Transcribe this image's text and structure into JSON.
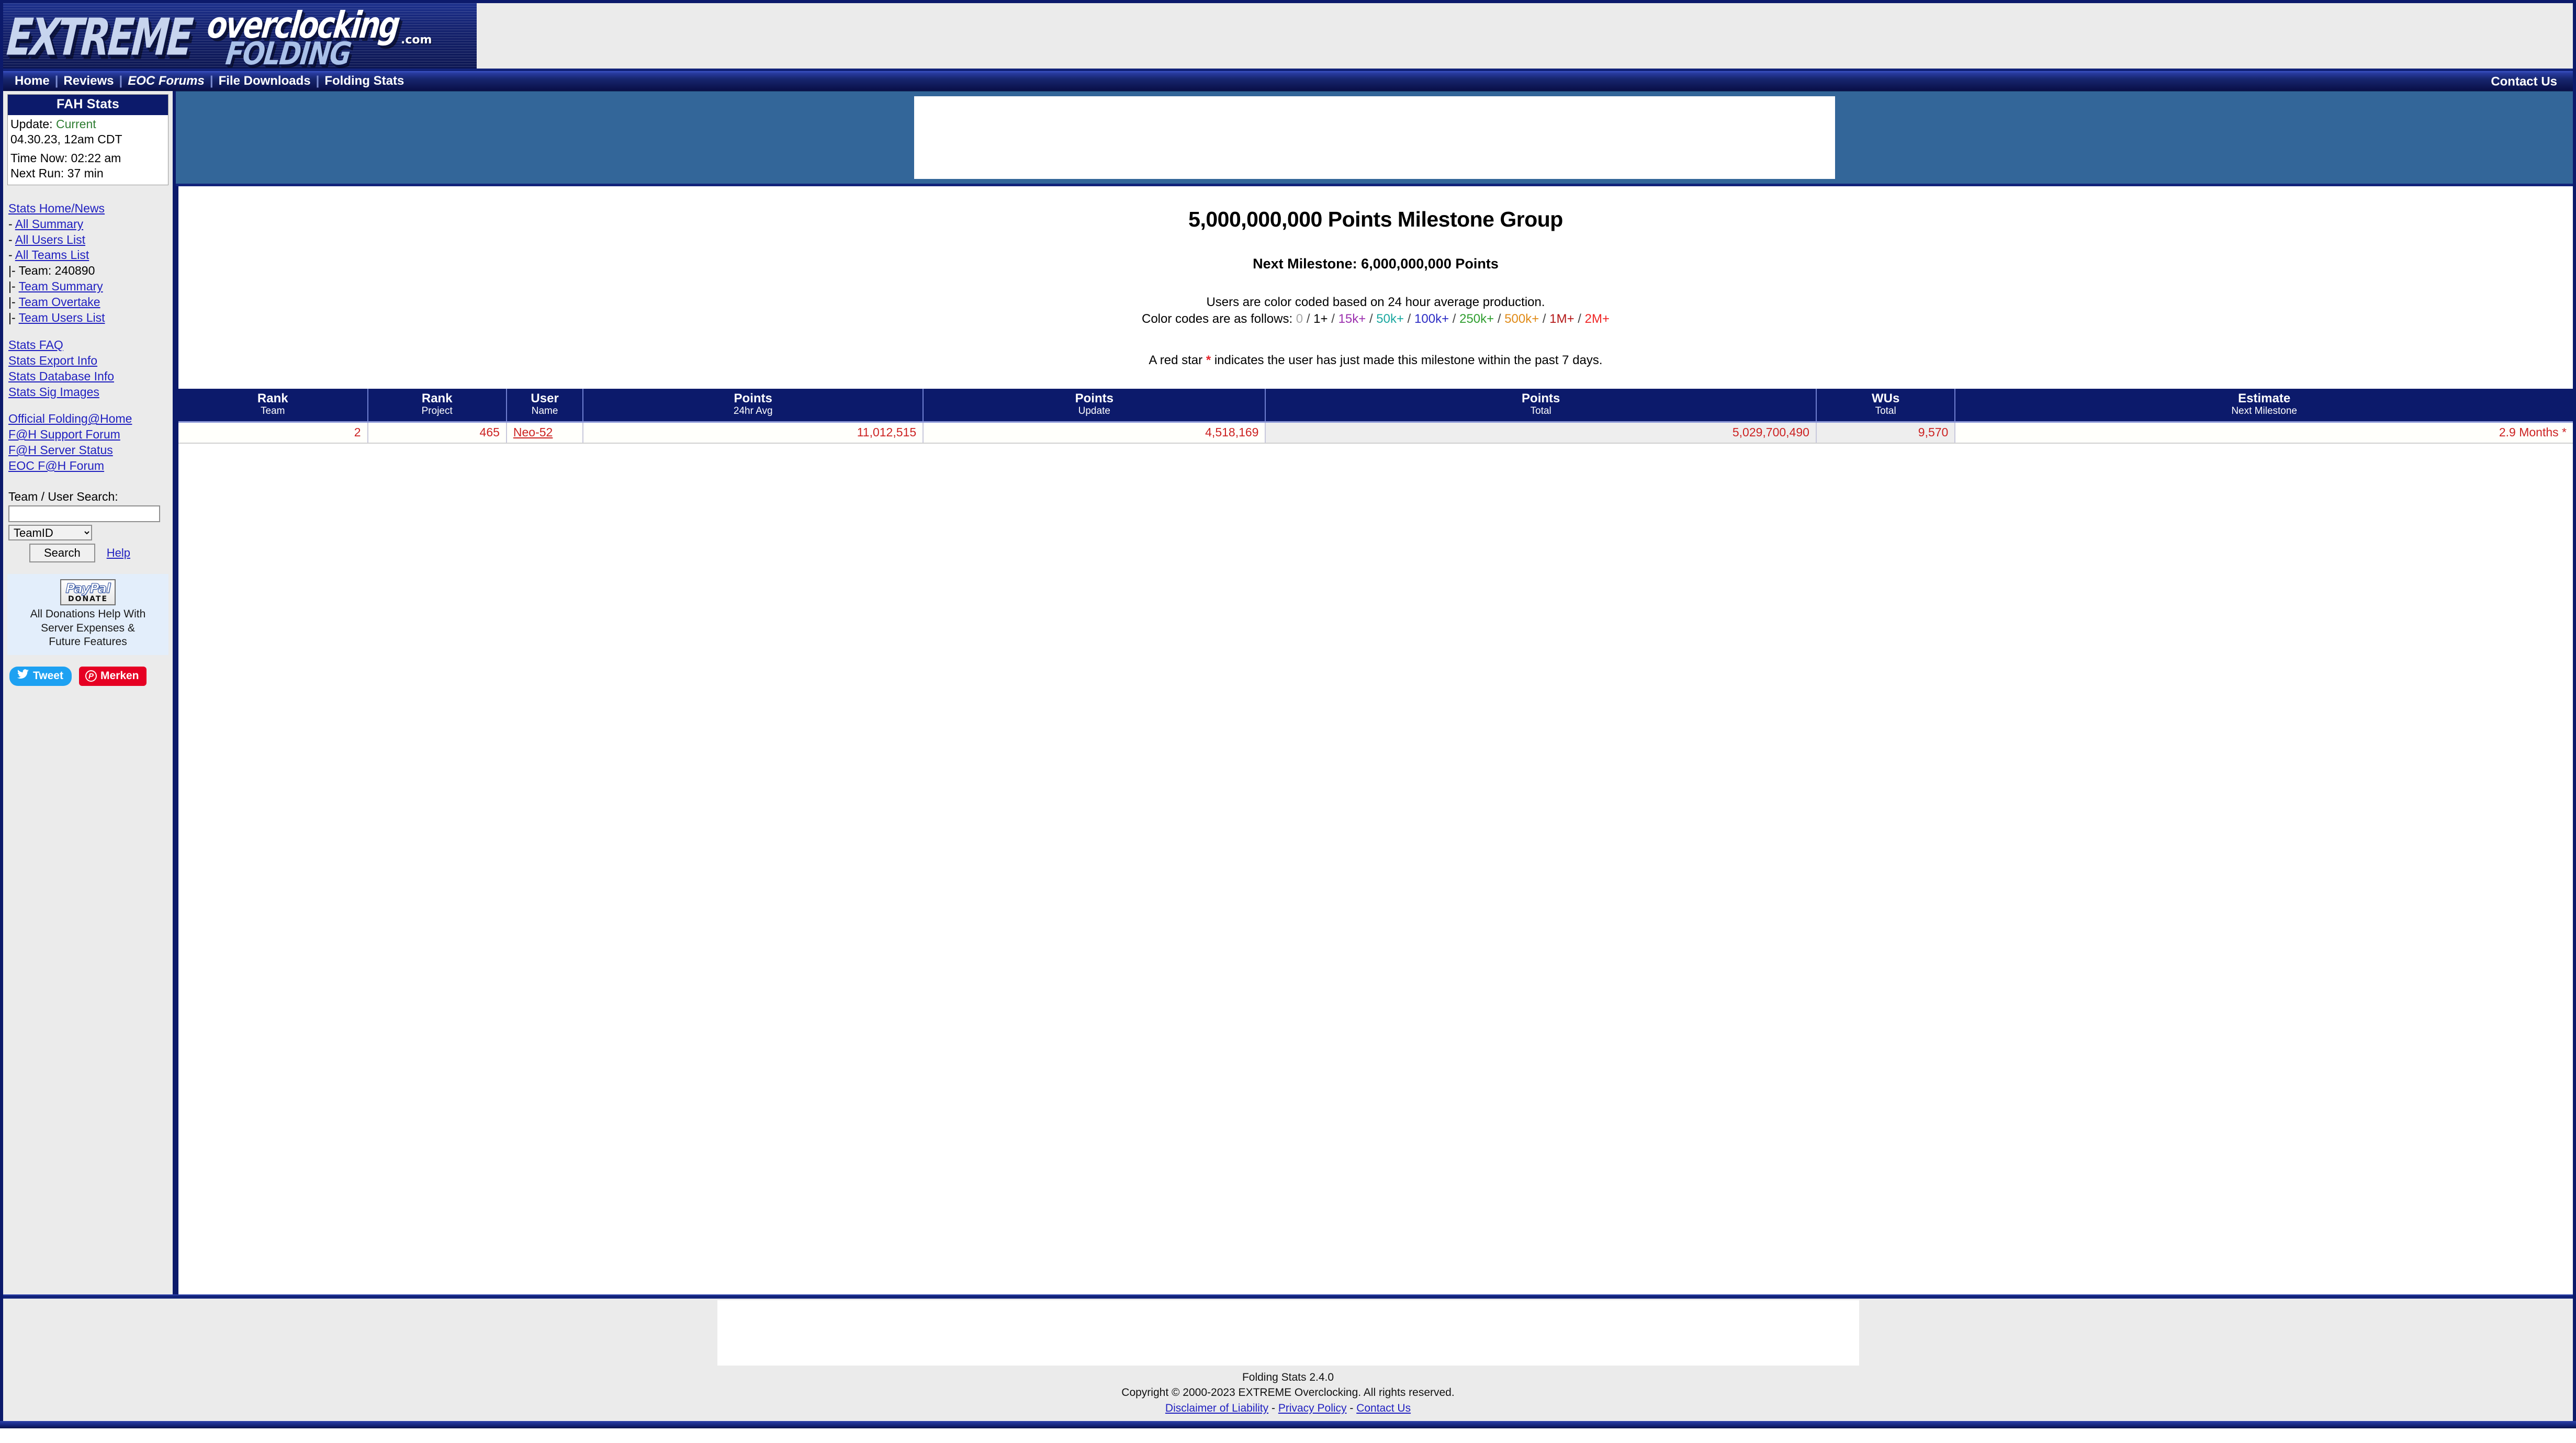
{
  "site": {
    "logo_line1": "EXTREME",
    "logo_line2": "overclocking",
    "logo_line3": "FOLDING",
    "logo_dotcom": ".com"
  },
  "nav": {
    "items": [
      {
        "label": "Home",
        "italic": false
      },
      {
        "label": "Reviews",
        "italic": false
      },
      {
        "label": "EOC Forums",
        "italic": true
      },
      {
        "label": "File Downloads",
        "italic": false
      },
      {
        "label": "Folding Stats",
        "italic": false
      }
    ],
    "separator": "|",
    "contact": "Contact Us"
  },
  "sidebar": {
    "panel_title": "FAH Stats",
    "update_label": "Update:",
    "update_status": "Current",
    "update_date": "04.30.23, 12am CDT",
    "time_now": "Time Now: 02:22 am",
    "next_run": "Next Run: 37 min",
    "nav_links": [
      {
        "prefix": "",
        "label": "Stats Home/News",
        "link": true
      },
      {
        "prefix": "- ",
        "label": "All Summary",
        "link": true
      },
      {
        "prefix": "- ",
        "label": "All Users List",
        "link": true
      },
      {
        "prefix": "- ",
        "label": "All Teams List",
        "link": true
      },
      {
        "prefix": "|- ",
        "label": "Team: 240890",
        "link": false
      },
      {
        "prefix": "|- ",
        "label": "Team Summary",
        "link": true
      },
      {
        "prefix": "|- ",
        "label": "Team Overtake",
        "link": true
      },
      {
        "prefix": "|- ",
        "label": "Team Users List",
        "link": true
      }
    ],
    "stats_links": [
      {
        "label": "Stats FAQ"
      },
      {
        "label": "Stats Export Info"
      },
      {
        "label": "Stats Database Info"
      },
      {
        "label": "Stats Sig Images"
      }
    ],
    "external_links": [
      {
        "label": "Official Folding@Home"
      },
      {
        "label": "F@H Support Forum"
      },
      {
        "label": "F@H Server Status"
      },
      {
        "label": "EOC F@H Forum"
      }
    ],
    "search": {
      "label": "Team / User Search:",
      "value": "",
      "placeholder": "",
      "select_value": "TeamID",
      "button_label": "Search",
      "help_label": "Help"
    },
    "donate": {
      "paypal_word": "PayPal",
      "paypal_sub": "DONATE",
      "line1": "All Donations Help With",
      "line2": "Server Expenses &",
      "line3": "Future Features"
    },
    "social": {
      "tweet_label": "Tweet",
      "pin_label": "Merken",
      "pin_glyph": "P"
    }
  },
  "main": {
    "heading": "5,000,000,000 Points Milestone Group",
    "subheading": "Next Milestone: 6,000,000,000 Points",
    "note_line1": "Users are color coded based on 24 hour average production.",
    "note_line2_prefix": "Color codes are as follows: ",
    "color_codes": [
      {
        "label": "0",
        "color": "#a9a9a9"
      },
      {
        "label": "1+",
        "color": "#000000"
      },
      {
        "label": "15k+",
        "color": "#9b2fae"
      },
      {
        "label": "50k+",
        "color": "#1aa8a0"
      },
      {
        "label": "100k+",
        "color": "#2b2bc4"
      },
      {
        "label": "250k+",
        "color": "#2f9e2f"
      },
      {
        "label": "500k+",
        "color": "#e08a16"
      },
      {
        "label": "1M+",
        "color": "#b31616"
      },
      {
        "label": "2M+",
        "color": "#ef2525"
      }
    ],
    "star_note_before": "A red star ",
    "star_symbol": "*",
    "star_note_after": " indicates the user has just made this milestone within the past 7 days."
  },
  "table": {
    "columns": [
      {
        "main": "Rank",
        "sub": "Team"
      },
      {
        "main": "Rank",
        "sub": "Project"
      },
      {
        "main": "User",
        "sub": "Name"
      },
      {
        "main": "Points",
        "sub": "24hr Avg"
      },
      {
        "main": "Points",
        "sub": "Update"
      },
      {
        "main": "Points",
        "sub": "Total"
      },
      {
        "main": "WUs",
        "sub": "Total"
      },
      {
        "main": "Estimate",
        "sub": "Next Milestone"
      }
    ],
    "rows": [
      {
        "rank_team": "2",
        "rank_project": "465",
        "user_name": "Neo-52",
        "points_24hr": "11,012,515",
        "points_update": "4,518,169",
        "points_total": "5,029,700,490",
        "wus_total": "9,570",
        "estimate": "2.9 Months *"
      }
    ]
  },
  "footer": {
    "version": "Folding Stats 2.4.0",
    "copyright": "Copyright © 2000-2023 EXTREME Overclocking. All rights reserved.",
    "links": [
      {
        "label": "Disclaimer of Liability"
      },
      {
        "label": "Privacy Policy"
      },
      {
        "label": "Contact Us"
      }
    ],
    "link_sep": " - "
  }
}
